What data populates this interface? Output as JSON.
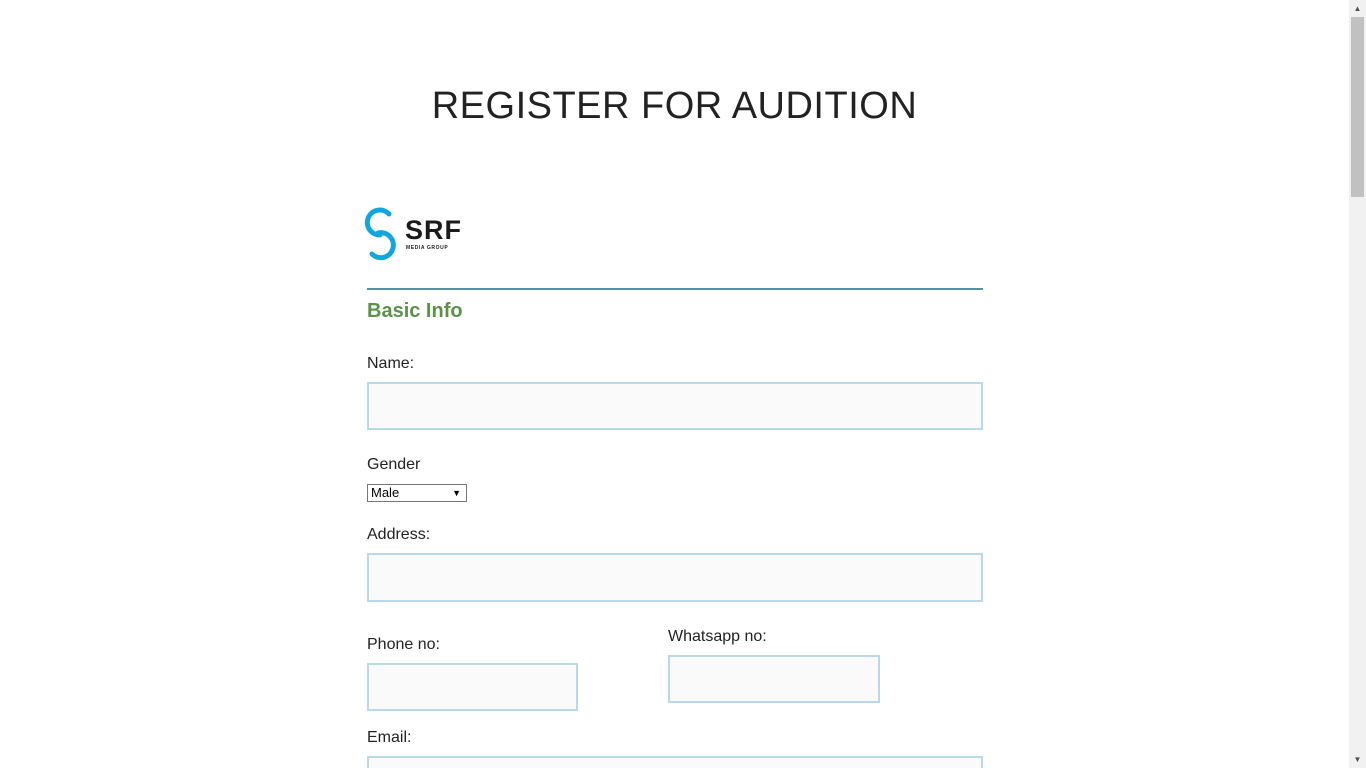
{
  "page": {
    "title": "REGISTER FOR AUDITION"
  },
  "logo": {
    "word": "SRF",
    "subtext": "MEDIA GROUP",
    "accent_color": "#12a6df"
  },
  "form": {
    "section_title": "Basic Info",
    "name_label": "Name:",
    "name_value": "",
    "gender_label": "Gender",
    "gender_selected": "Male",
    "address_label": "Address:",
    "address_value": "",
    "phone_label": "Phone no:",
    "phone_value": "",
    "whatsapp_label": "Whatsapp no:",
    "whatsapp_value": "",
    "email_label": "Email:",
    "email_value": ""
  },
  "colors": {
    "section_title": "#5b9148",
    "divider": "#5a8ea2",
    "input_border": "#b9d9ea"
  }
}
